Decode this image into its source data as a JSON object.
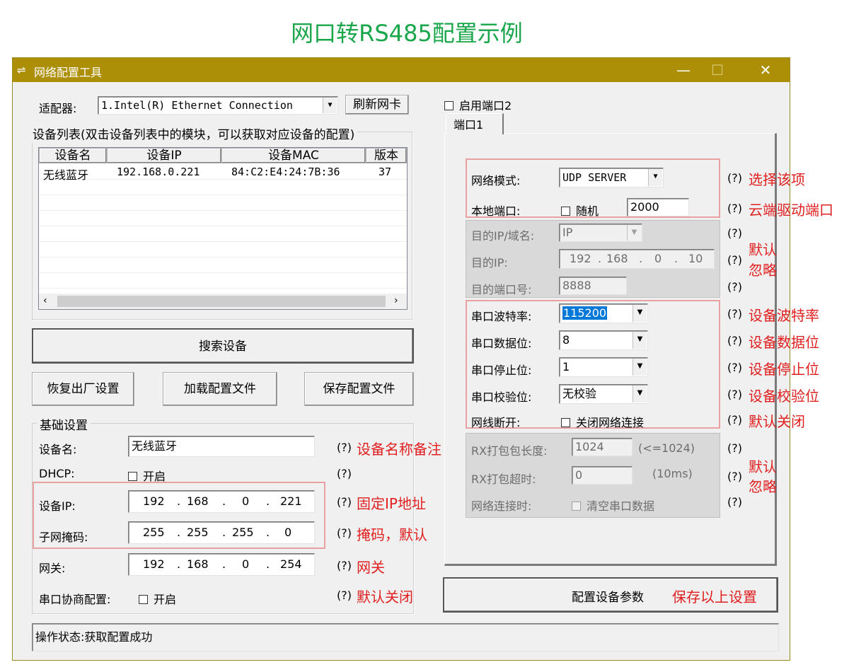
{
  "page_title": "网口转RS485配置示例",
  "window": {
    "title": "网络配置工具",
    "controls": {
      "minimize": "—",
      "maximize": "☐",
      "close": "✕"
    }
  },
  "left": {
    "adapter_label": "适配器:",
    "adapter_value": "1.Intel(R) Ethernet Connection",
    "refresh_button": "刷新网卡",
    "device_list_title": "设备列表(双击设备列表中的模块，可以获取对应设备的配置)",
    "columns": [
      "设备名",
      "设备IP",
      "设备MAC",
      "版本"
    ],
    "rows": [
      {
        "name": "无线蓝牙",
        "ip": "192.168.0.221",
        "mac": "84:C2:E4:24:7B:36",
        "version": "37"
      }
    ],
    "search_button": "搜索设备",
    "factory_button": "恢复出厂设置",
    "load_button": "加载配置文件",
    "save_file_button": "保存配置文件",
    "basic_title": "基础设置",
    "device_name_label": "设备名:",
    "device_name_value": "无线蓝牙",
    "dhcp_label": "DHCP:",
    "dhcp_option": "开启",
    "ip_label": "设备IP:",
    "ip": [
      "192",
      "168",
      "0",
      "221"
    ],
    "mask_label": "子网掩码:",
    "mask": [
      "255",
      "255",
      "255",
      "0"
    ],
    "gateway_label": "网关:",
    "gateway": [
      "192",
      "168",
      "0",
      "254"
    ],
    "serial_neg_label": "串口协商配置:",
    "serial_neg_option": "开启",
    "q": "(?)",
    "ann_name": "设备名称备注",
    "ann_ip": "固定IP地址",
    "ann_mask": "掩码，默认",
    "ann_gw": "网关",
    "ann_neg": "默认关闭",
    "status": "操作状态:获取配置成功"
  },
  "right": {
    "enable_port2": "启用端口2",
    "tab_port1": "端口1",
    "net_mode_label": "网络模式:",
    "net_mode_value": "UDP SERVER",
    "local_port_label": "本地端口:",
    "random_label": "随机",
    "local_port_value": "2000",
    "dest_ip_domain_label": "目的IP/域名:",
    "dest_ip_domain_value": "IP",
    "dest_ip_label": "目的IP:",
    "dest_ip": [
      "192",
      "168",
      "0",
      "10"
    ],
    "dest_port_label": "目的端口号:",
    "dest_port_value": "8888",
    "baud_label": "串口波特率:",
    "baud_value": "115200",
    "databits_label": "串口数据位:",
    "databits_value": "8",
    "stopbits_label": "串口停止位:",
    "stopbits_value": "1",
    "parity_label": "串口校验位:",
    "parity_value": "无校验",
    "disconnect_label": "网线断开:",
    "disconnect_option": "关闭网络连接",
    "rx_len_label": "RX打包包长度:",
    "rx_len_value": "1024",
    "rx_len_hint": "(<=1024)",
    "rx_timeout_label": "RX打包超时:",
    "rx_timeout_value": "0",
    "rx_timeout_hint": "(10ms)",
    "net_connect_label": "网络连接时:",
    "net_connect_option": "清空串口数据",
    "q": "(?)",
    "ann_mode": "选择该项",
    "ann_port": "云端驱动端口",
    "ann_default_1": "默认",
    "ann_ignore_1": "忽略",
    "ann_baud": "设备波特率",
    "ann_databits": "设备数据位",
    "ann_stopbits": "设备停止位",
    "ann_parity": "设备校验位",
    "ann_disconnect": "默认关闭",
    "ann_default_2": "默认",
    "ann_ignore_2": "忽略",
    "config_button": "配置设备参数",
    "ann_save": "保存以上设置"
  }
}
